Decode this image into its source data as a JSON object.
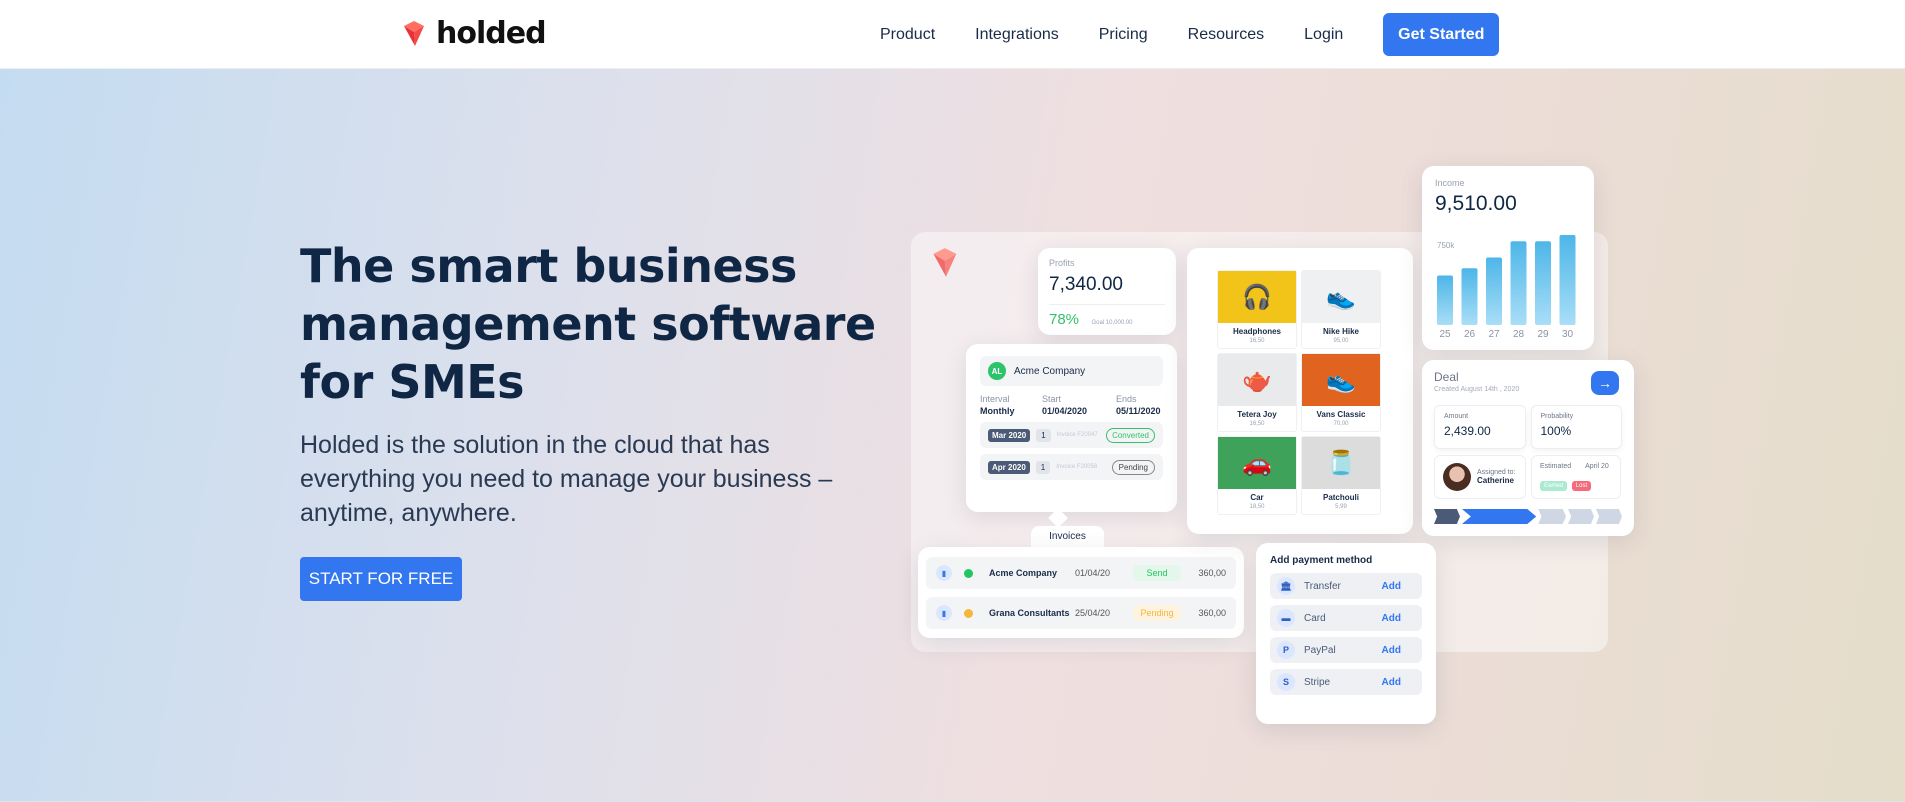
{
  "header": {
    "logo_text": "holded",
    "nav": [
      "Product",
      "Integrations",
      "Pricing",
      "Resources",
      "Login"
    ],
    "cta": "Get Started"
  },
  "hero": {
    "headline": "The smart business management software for SMEs",
    "subtext": "Holded is the solution in the cloud that has everything you need to manage your business – anytime, anywhere.",
    "cta": "START FOR FREE"
  },
  "mockup": {
    "profits": {
      "label": "Profits",
      "value": "7,340.00",
      "percent": "78%",
      "goal": "Goal  10,000.00"
    },
    "subscription": {
      "company": "Acme Company",
      "avatar": "AL",
      "headers": [
        "Interval",
        "Start",
        "Ends"
      ],
      "values": [
        "Monthly",
        "01/04/2020",
        "05/11/2020"
      ],
      "rows": [
        {
          "month": "Mar 2020",
          "count": "1",
          "ref": "Invoice F20047",
          "status": "Converted"
        },
        {
          "month": "Apr 2020",
          "count": "1",
          "ref": "Invoice F20058",
          "status": "Pending"
        }
      ]
    },
    "invoices": {
      "tab": "Invoices",
      "rows": [
        {
          "name": "Acme Company",
          "date": "01/04/20",
          "status": "Send",
          "amount": "360,00",
          "dot_color": "#22c55e",
          "status_color": "#22c55e",
          "status_bg": "#e3f7ea"
        },
        {
          "name": "Grana Consultants",
          "date": "25/04/20",
          "status": "Pending",
          "amount": "360,00",
          "dot_color": "#f5b63b",
          "status_color": "#f5b63b",
          "status_bg": "#fdf3df"
        }
      ]
    },
    "products": [
      {
        "name": "Headphones",
        "price": "16,50",
        "icon": "headphones-icon",
        "glyph": "🎧",
        "bg": "#f2c318"
      },
      {
        "name": "Nike Hike",
        "price": "95,00",
        "icon": "shoe-icon",
        "glyph": "👟",
        "bg": "#eef0f2"
      },
      {
        "name": "Tetera Joy",
        "price": "16,50",
        "icon": "kettle-icon",
        "glyph": "🫖",
        "bg": "#e9eaec"
      },
      {
        "name": "Vans Classic",
        "price": "70,00",
        "icon": "sneaker-icon",
        "glyph": "👟",
        "bg": "#e0631f"
      },
      {
        "name": "Car",
        "price": "18,50",
        "icon": "car-icon",
        "glyph": "🚗",
        "bg": "#3fa25b"
      },
      {
        "name": "Patchouli",
        "price": "5,99",
        "icon": "jar-icon",
        "glyph": "🫙",
        "bg": "#dcdcdc"
      }
    ],
    "income": {
      "label": "Income",
      "value": "9,510.00",
      "axis_label": "750k",
      "chart_data": {
        "type": "bar",
        "categories": [
          "25",
          "26",
          "27",
          "28",
          "29",
          "30"
        ],
        "values": [
          0.55,
          0.63,
          0.75,
          0.93,
          0.93,
          1.0
        ],
        "color": "#4db6e8"
      }
    },
    "deal": {
      "title": "Deal",
      "created": "Created August 14th , 2020",
      "amount_label": "Amount",
      "amount": "2,439.00",
      "probability_label": "Probability",
      "probability": "100%",
      "assigned_label": "Assigned to:",
      "assigned_name": "Catherine",
      "estimated_label": "Estimated",
      "estimated_date": "April 20",
      "badge_earned": "Earned",
      "badge_lost": "Lost",
      "pipeline_colors": [
        "#4b5a77",
        "#3276f0",
        "#cfd6e4",
        "#cfd6e4",
        "#cfd6e4"
      ]
    },
    "payment": {
      "title": "Add payment method",
      "add_label": "Add",
      "methods": [
        {
          "name": "Transfer",
          "icon": "bank-icon",
          "glyph": "🏛"
        },
        {
          "name": "Card",
          "icon": "card-icon",
          "glyph": "▬"
        },
        {
          "name": "PayPal",
          "icon": "paypal-icon",
          "glyph": "P"
        },
        {
          "name": "Stripe",
          "icon": "stripe-icon",
          "glyph": "S"
        }
      ]
    }
  }
}
